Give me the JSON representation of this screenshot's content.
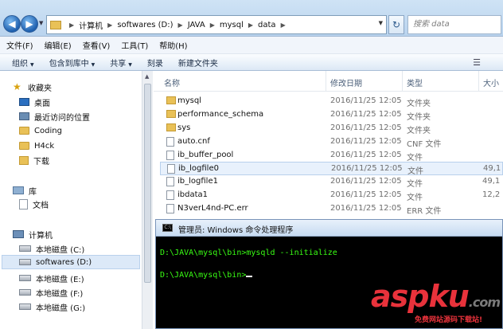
{
  "address_bar": {
    "crumbs": [
      "计算机",
      "softwares (D:)",
      "JAVA",
      "mysql",
      "data"
    ],
    "search_placeholder": "搜索 data"
  },
  "menu": [
    "文件(F)",
    "编辑(E)",
    "查看(V)",
    "工具(T)",
    "帮助(H)"
  ],
  "toolbar": {
    "organize": "组织",
    "include_in_library": "包含到库中",
    "share": "共享",
    "burn": "刻录",
    "new_folder": "新建文件夹"
  },
  "nav_pane": {
    "favorites_header": "收藏夹",
    "favorites": [
      "桌面",
      "最近访问的位置",
      "Coding",
      "H4ck",
      "下载"
    ],
    "libraries_header": "库",
    "libraries": [
      "文档"
    ],
    "computer_header": "计算机",
    "drives": [
      "本地磁盘 (C:)",
      "softwares (D:)",
      "本地磁盘 (E:)",
      "本地磁盘 (F:)",
      "本地磁盘 (G:)"
    ]
  },
  "columns": {
    "name": "名称",
    "modified": "修改日期",
    "type": "类型",
    "size": "大小"
  },
  "files": [
    {
      "name": "mysql",
      "modified": "2016/11/25 12:05",
      "type": "文件夹",
      "size": ""
    },
    {
      "name": "performance_schema",
      "modified": "2016/11/25 12:05",
      "type": "文件夹",
      "size": ""
    },
    {
      "name": "sys",
      "modified": "2016/11/25 12:05",
      "type": "文件夹",
      "size": ""
    },
    {
      "name": "auto.cnf",
      "modified": "2016/11/25 12:05",
      "type": "CNF 文件",
      "size": ""
    },
    {
      "name": "ib_buffer_pool",
      "modified": "2016/11/25 12:05",
      "type": "文件",
      "size": ""
    },
    {
      "name": "ib_logfile0",
      "modified": "2016/11/25 12:05",
      "type": "文件",
      "size": "49,1"
    },
    {
      "name": "ib_logfile1",
      "modified": "2016/11/25 12:05",
      "type": "文件",
      "size": "49,1"
    },
    {
      "name": "ibdata1",
      "modified": "2016/11/25 12:05",
      "type": "文件",
      "size": "12,2"
    },
    {
      "name": "N3verL4nd-PC.err",
      "modified": "2016/11/25 12:05",
      "type": "ERR 文件",
      "size": ""
    }
  ],
  "cmd": {
    "title": "管理员: Windows 命令处理程序",
    "line1": "D:\\JAVA\\mysql\\bin>mysqld --initialize",
    "line2": "D:\\JAVA\\mysql\\bin>"
  },
  "watermark": {
    "logo_main": "aspku",
    "logo_suffix": ".com",
    "subtitle": "免费网站源码下载站!"
  }
}
